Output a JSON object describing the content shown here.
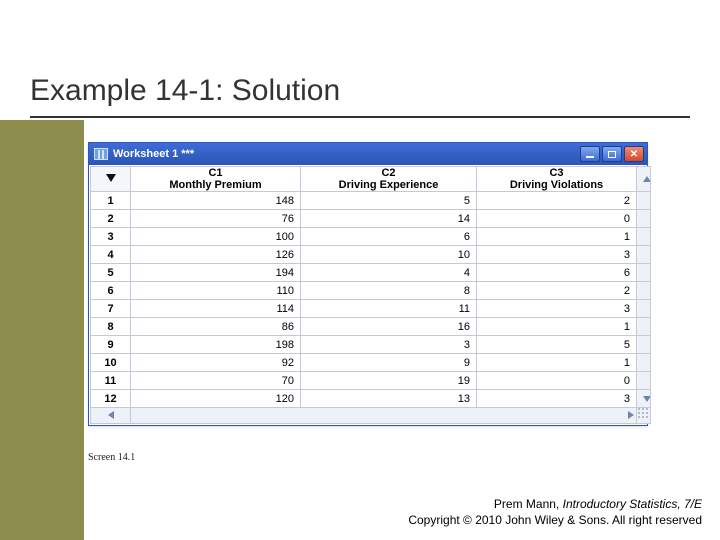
{
  "title": "Example 14-1: Solution",
  "window": {
    "title": "Worksheet 1 ***",
    "columns": [
      {
        "id": "C1",
        "label": "Monthly Premium"
      },
      {
        "id": "C2",
        "label": "Driving Experience"
      },
      {
        "id": "C3",
        "label": "Driving Violations"
      }
    ],
    "rows": [
      {
        "n": "1",
        "c1": "148",
        "c2": "5",
        "c3": "2"
      },
      {
        "n": "2",
        "c1": "76",
        "c2": "14",
        "c3": "0"
      },
      {
        "n": "3",
        "c1": "100",
        "c2": "6",
        "c3": "1"
      },
      {
        "n": "4",
        "c1": "126",
        "c2": "10",
        "c3": "3"
      },
      {
        "n": "5",
        "c1": "194",
        "c2": "4",
        "c3": "6"
      },
      {
        "n": "6",
        "c1": "110",
        "c2": "8",
        "c3": "2"
      },
      {
        "n": "7",
        "c1": "114",
        "c2": "11",
        "c3": "3"
      },
      {
        "n": "8",
        "c1": "86",
        "c2": "16",
        "c3": "1"
      },
      {
        "n": "9",
        "c1": "198",
        "c2": "3",
        "c3": "5"
      },
      {
        "n": "10",
        "c1": "92",
        "c2": "9",
        "c3": "1"
      },
      {
        "n": "11",
        "c1": "70",
        "c2": "19",
        "c3": "0"
      },
      {
        "n": "12",
        "c1": "120",
        "c2": "13",
        "c3": "3"
      }
    ]
  },
  "caption": "Screen 14.1",
  "footer": {
    "author": "Prem Mann, ",
    "book": "Introductory Statistics, 7/E",
    "copyright": "Copyright © 2010 John Wiley & Sons. All right reserved"
  },
  "chart_data": {
    "type": "table",
    "title": "Worksheet 1",
    "columns": [
      "Monthly Premium",
      "Driving Experience",
      "Driving Violations"
    ],
    "rows": [
      [
        148,
        5,
        2
      ],
      [
        76,
        14,
        0
      ],
      [
        100,
        6,
        1
      ],
      [
        126,
        10,
        3
      ],
      [
        194,
        4,
        6
      ],
      [
        110,
        8,
        2
      ],
      [
        114,
        11,
        3
      ],
      [
        86,
        16,
        1
      ],
      [
        198,
        3,
        5
      ],
      [
        92,
        9,
        1
      ],
      [
        70,
        19,
        0
      ],
      [
        120,
        13,
        3
      ]
    ]
  }
}
